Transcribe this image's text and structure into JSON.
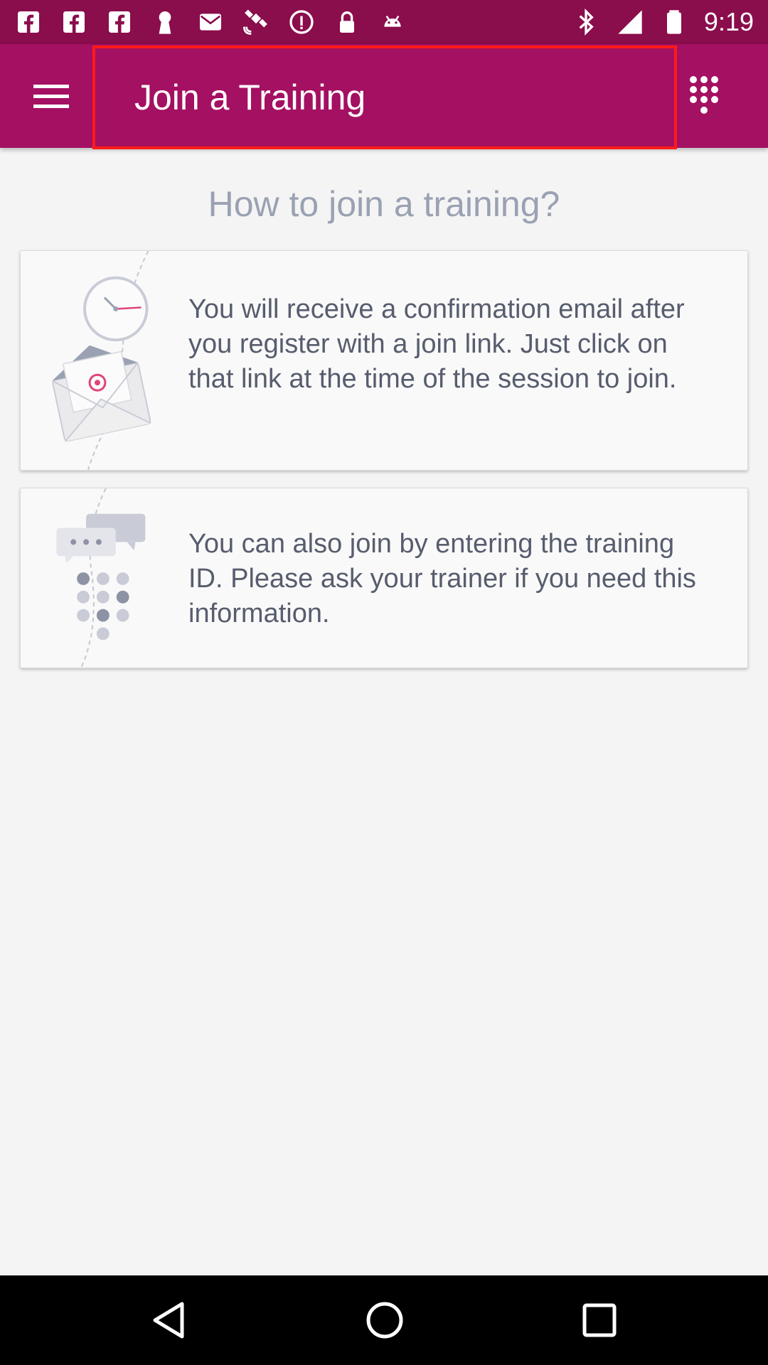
{
  "status_bar": {
    "time": "9:19",
    "icons": [
      "facebook-icon",
      "facebook-icon",
      "facebook-icon",
      "keyhole-icon",
      "mail-icon",
      "satellite-icon",
      "info-icon",
      "lock-icon",
      "android-icon",
      "bluetooth-icon",
      "signal-icon",
      "battery-icon"
    ]
  },
  "app_bar": {
    "title": "Join a Training",
    "menu_icon": "hamburger-menu-icon",
    "dialpad_icon": "dialpad-icon"
  },
  "main": {
    "heading": "How to join a training?",
    "cards": [
      {
        "illustration": "clock-envelope-icon",
        "text": "You will receive a confirmation email after you register with a join link. Just click on that link at the time of the session to join."
      },
      {
        "illustration": "chat-dialpad-icon",
        "text": "You can also join by entering the training ID. Please ask your trainer if you need this information."
      }
    ]
  },
  "nav_bar": {
    "icons": [
      "back-icon",
      "home-icon",
      "recents-icon"
    ]
  },
  "colors": {
    "status_bar": "#8a0d4c",
    "app_bar": "#a41062",
    "highlight_border": "#ff1a1a",
    "heading_text": "#9aa1b3",
    "body_text": "#575d6e",
    "background": "#f4f4f4"
  }
}
